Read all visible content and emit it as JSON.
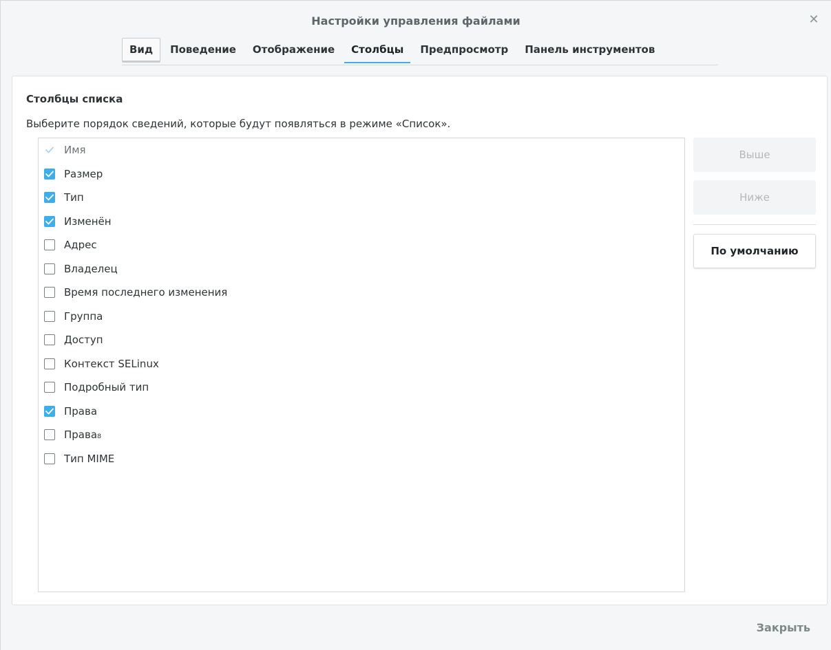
{
  "window": {
    "title": "Настройки управления файлами",
    "close_icon": "close-icon"
  },
  "tabs": [
    {
      "label": "Вид",
      "state": "focused"
    },
    {
      "label": "Поведение",
      "state": "normal"
    },
    {
      "label": "Отображение",
      "state": "normal"
    },
    {
      "label": "Столбцы",
      "state": "active"
    },
    {
      "label": "Предпросмотр",
      "state": "normal"
    },
    {
      "label": "Панель инструментов",
      "state": "normal"
    }
  ],
  "section": {
    "title": "Столбцы списка",
    "description": "Выберите порядок сведений, которые будут появляться в режиме «Список»."
  },
  "columns": [
    {
      "label": "Имя",
      "checked": true,
      "disabled": true
    },
    {
      "label": "Размер",
      "checked": true,
      "disabled": false
    },
    {
      "label": "Тип",
      "checked": true,
      "disabled": false
    },
    {
      "label": "Изменён",
      "checked": true,
      "disabled": false
    },
    {
      "label": "Адрес",
      "checked": false,
      "disabled": false
    },
    {
      "label": "Владелец",
      "checked": false,
      "disabled": false
    },
    {
      "label": "Время последнего изменения",
      "checked": false,
      "disabled": false
    },
    {
      "label": "Группа",
      "checked": false,
      "disabled": false
    },
    {
      "label": "Доступ",
      "checked": false,
      "disabled": false
    },
    {
      "label": "Контекст SELinux",
      "checked": false,
      "disabled": false
    },
    {
      "label": "Подробный тип",
      "checked": false,
      "disabled": false
    },
    {
      "label": "Права",
      "checked": true,
      "disabled": false
    },
    {
      "label": "Права₈",
      "checked": false,
      "disabled": false
    },
    {
      "label": "Тип MIME",
      "checked": false,
      "disabled": false
    }
  ],
  "buttons": {
    "up": "Выше",
    "down": "Ниже",
    "default": "По умолчанию",
    "close": "Закрыть"
  },
  "colors": {
    "accent": "#3daee9",
    "background": "#f5f6f7",
    "text": "#2e3436"
  }
}
